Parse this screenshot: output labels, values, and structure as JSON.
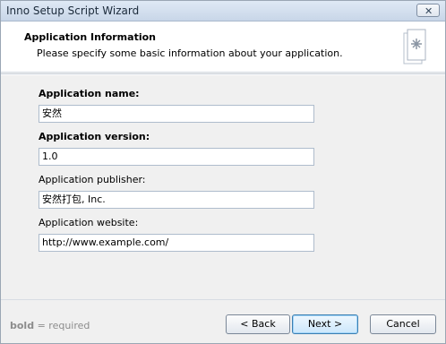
{
  "window": {
    "title": "Inno Setup Script Wizard",
    "close_glyph": "✕"
  },
  "header": {
    "title": "Application Information",
    "subtitle": "Please specify some basic information about your application.",
    "icon": "wizard-page-icon"
  },
  "fields": [
    {
      "label": "Application name:",
      "value": "安然",
      "required": true
    },
    {
      "label": "Application version:",
      "value": "1.0",
      "required": true
    },
    {
      "label": "Application publisher:",
      "value": "安然打包, Inc.",
      "required": false
    },
    {
      "label": "Application website:",
      "value": "http://www.example.com/",
      "required": false
    }
  ],
  "legend": {
    "bold": "bold",
    "rest": " = required"
  },
  "buttons": {
    "back": "< Back",
    "next": "Next >",
    "cancel": "Cancel"
  }
}
